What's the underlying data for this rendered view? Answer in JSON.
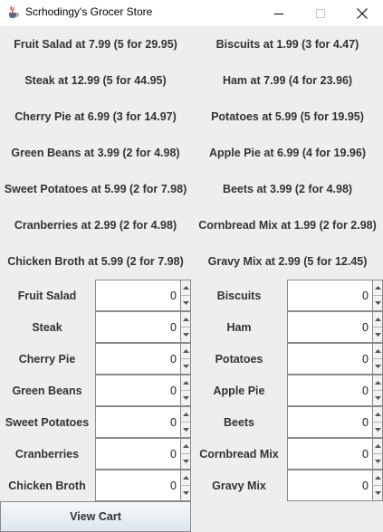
{
  "window": {
    "title": "Scrhodingy's Grocer Store",
    "icon": "java-cup-icon",
    "controls": [
      "minimize-icon",
      "maximize-icon",
      "close-icon"
    ]
  },
  "prices": [
    [
      "Fruit Salad at 7.99 (5 for 29.95)",
      "Biscuits at 1.99 (3 for 4.47)"
    ],
    [
      "Steak at 12.99 (5 for 44.95)",
      "Ham at 7.99 (4 for 23.96)"
    ],
    [
      "Cherry Pie at 6.99 (3 for 14.97)",
      "Potatoes at 5.99 (5 for 19.95)"
    ],
    [
      "Green Beans at 3.99 (2 for 4.98)",
      "Apple Pie at 6.99 (4 for 19.96)"
    ],
    [
      "Sweet Potatoes at 5.99 (2 for 7.98)",
      "Beets at 3.99 (2 for 4.98)"
    ],
    [
      "Cranberries at 2.99 (2 for 4.98)",
      "Cornbread Mix at 1.99 (2 for 2.98)"
    ],
    [
      "Chicken Broth at 5.99 (2 for 7.98)",
      "Gravy Mix at 2.99 (5 for 12.45)"
    ]
  ],
  "quantities": [
    [
      {
        "label": "Fruit Salad",
        "value": "0"
      },
      {
        "label": "Biscuits",
        "value": "0"
      }
    ],
    [
      {
        "label": "Steak",
        "value": "0"
      },
      {
        "label": "Ham",
        "value": "0"
      }
    ],
    [
      {
        "label": "Cherry Pie",
        "value": "0"
      },
      {
        "label": "Potatoes",
        "value": "0"
      }
    ],
    [
      {
        "label": "Green Beans",
        "value": "0"
      },
      {
        "label": "Apple Pie",
        "value": "0"
      }
    ],
    [
      {
        "label": "Sweet Potatoes",
        "value": "0"
      },
      {
        "label": "Beets",
        "value": "0"
      }
    ],
    [
      {
        "label": "Cranberries",
        "value": "0"
      },
      {
        "label": "Cornbread Mix",
        "value": "0"
      }
    ],
    [
      {
        "label": "Chicken Broth",
        "value": "0"
      },
      {
        "label": "Gravy Mix",
        "value": "0"
      }
    ]
  ],
  "view_cart_label": "View Cart"
}
